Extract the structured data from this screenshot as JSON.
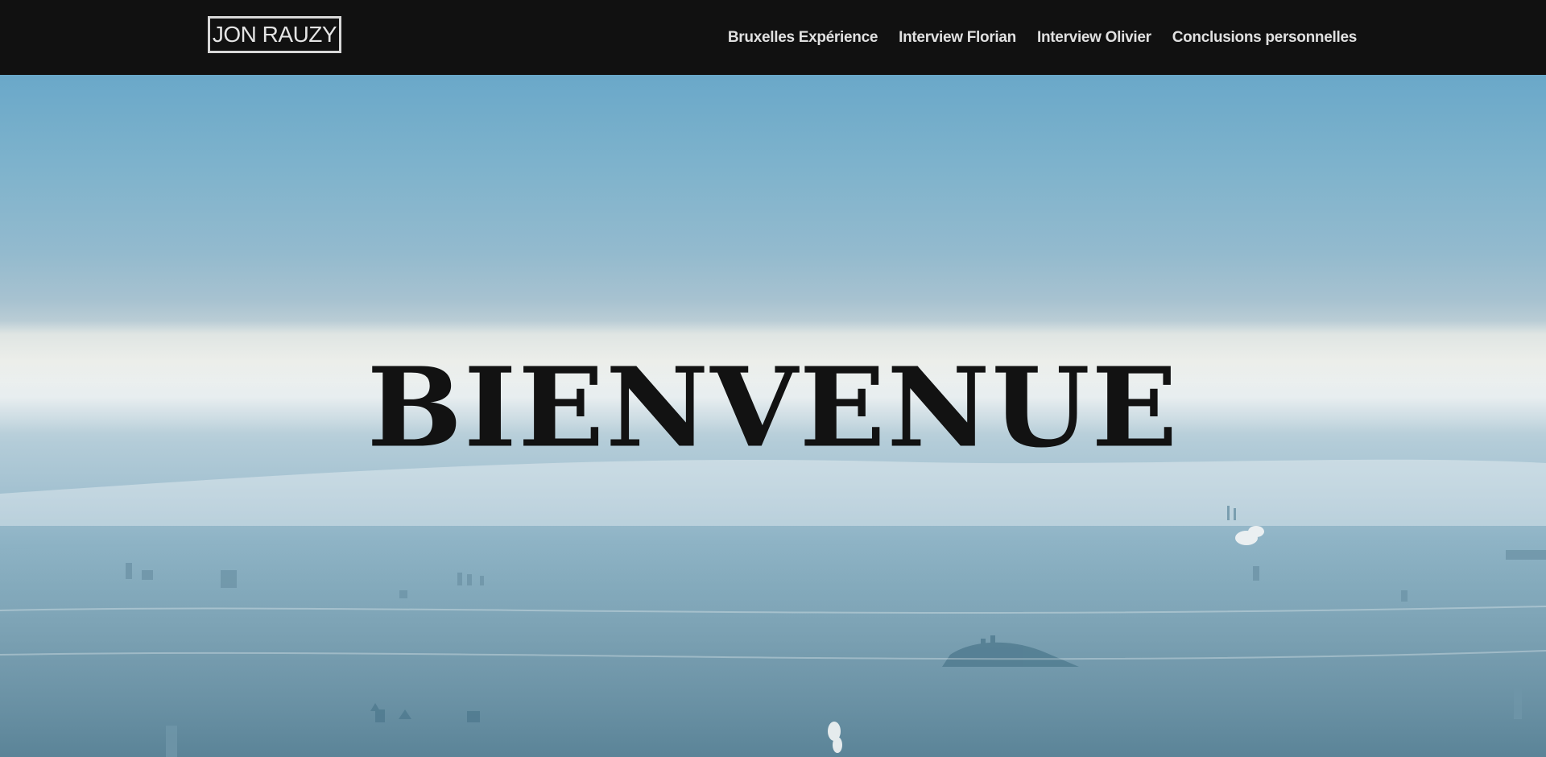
{
  "header": {
    "logo_text": "JON RAUZY",
    "nav": [
      {
        "label": "Bruxelles Expérience"
      },
      {
        "label": "Interview Florian"
      },
      {
        "label": "Interview Olivier"
      },
      {
        "label": "Conclusions personnelles"
      }
    ]
  },
  "hero": {
    "title": "BIENVENUE",
    "background_description_icon": "aerial-city-fog-image"
  },
  "colors": {
    "header_bg": "#111111",
    "nav_text": "#e0e0e0",
    "title_text": "#121212",
    "sky_top": "#6aa8c9",
    "fog": "#eceeea"
  }
}
